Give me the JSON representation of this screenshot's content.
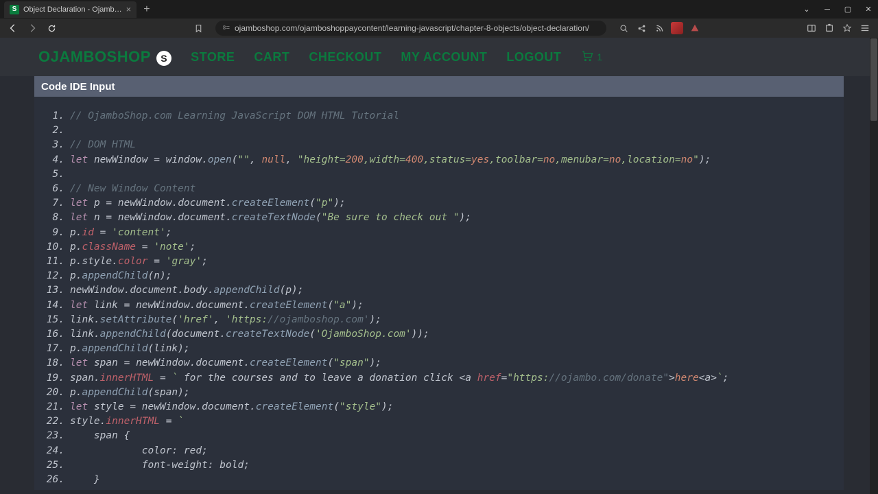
{
  "browser": {
    "tab_title": "Object Declaration - Ojamb…",
    "url": "ojamboshop.com/ojamboshoppaycontent/learning-javascript/chapter-8-objects/object-declaration/",
    "cart_count": "1"
  },
  "nav": {
    "brand": "OJAMBOSHOP",
    "links": [
      "STORE",
      "CART",
      "CHECKOUT",
      "MY ACCOUNT",
      "LOGOUT"
    ]
  },
  "panel": {
    "title": "Code IDE Input"
  },
  "code_lines": [
    {
      "n": "1",
      "html": "<span class='cm'>// OjamboShop.com Learning JavaScript DOM HTML Tutorial</span>"
    },
    {
      "n": "2",
      "html": ""
    },
    {
      "n": "3",
      "html": "<span class='cm'>// DOM HTML</span>"
    },
    {
      "n": "4",
      "html": "<span class='kw'>let</span> <span class='id'>newWindow</span> <span class='op'>=</span> <span class='id'>window</span>.<span class='fn'>open</span><span class='pn'>(</span><span class='st'>\"\"</span><span class='pn'>,</span> <span class='bool'>null</span><span class='pn'>,</span> <span class='st'>\"height=</span><span class='nm'>200</span><span class='st'>,width=</span><span class='nm'>400</span><span class='st'>,status=</span><span class='bool'>yes</span><span class='st'>,toolbar=</span><span class='bool'>no</span><span class='st'>,menubar=</span><span class='bool'>no</span><span class='st'>,location=</span><span class='bool'>no</span><span class='st'>\"</span><span class='pn'>);</span>"
    },
    {
      "n": "5",
      "html": ""
    },
    {
      "n": "6",
      "html": "<span class='cm'>// New Window Content</span>"
    },
    {
      "n": "7",
      "html": "<span class='kw'>let</span> <span class='id'>p</span> <span class='op'>=</span> <span class='id'>newWindow</span>.<span class='id'>document</span>.<span class='fn'>createElement</span><span class='pn'>(</span><span class='st'>\"p\"</span><span class='pn'>);</span>"
    },
    {
      "n": "8",
      "html": "<span class='kw'>let</span> <span class='id'>n</span> <span class='op'>=</span> <span class='id'>newWindow</span>.<span class='id'>document</span>.<span class='fn'>createTextNode</span><span class='pn'>(</span><span class='st'>\"Be sure to check out \"</span><span class='pn'>);</span>"
    },
    {
      "n": "9",
      "html": "<span class='id'>p</span>.<span class='pr'>id</span> <span class='op'>=</span> <span class='st'>'content'</span><span class='pn'>;</span>"
    },
    {
      "n": "10",
      "html": "<span class='id'>p</span>.<span class='pr'>className</span> <span class='op'>=</span> <span class='st'>'note'</span><span class='pn'>;</span>"
    },
    {
      "n": "11",
      "html": "<span class='id'>p</span>.<span class='id'>style</span>.<span class='pr'>color</span> <span class='op'>=</span> <span class='st'>'gray'</span><span class='pn'>;</span>"
    },
    {
      "n": "12",
      "html": "<span class='id'>p</span>.<span class='fn'>appendChild</span><span class='pn'>(</span><span class='id'>n</span><span class='pn'>);</span>"
    },
    {
      "n": "13",
      "html": "<span class='id'>newWindow</span>.<span class='id'>document</span>.<span class='id'>body</span>.<span class='fn'>appendChild</span><span class='pn'>(</span><span class='id'>p</span><span class='pn'>);</span>"
    },
    {
      "n": "14",
      "html": "<span class='kw'>let</span> <span class='id'>link</span> <span class='op'>=</span> <span class='id'>newWindow</span>.<span class='id'>document</span>.<span class='fn'>createElement</span><span class='pn'>(</span><span class='st'>\"a\"</span><span class='pn'>);</span>"
    },
    {
      "n": "15",
      "html": "<span class='id'>link</span>.<span class='fn'>setAttribute</span><span class='pn'>(</span><span class='st'>'href'</span><span class='pn'>,</span> <span class='st'>'https:</span><span class='cm'>//ojamboshop.com'</span><span class='pn'>);</span>"
    },
    {
      "n": "16",
      "html": "<span class='id'>link</span>.<span class='fn'>appendChild</span><span class='pn'>(</span><span class='id'>document</span>.<span class='fn'>createTextNode</span><span class='pn'>(</span><span class='st'>'OjamboShop.com'</span><span class='pn'>));</span>"
    },
    {
      "n": "17",
      "html": "<span class='id'>p</span>.<span class='fn'>appendChild</span><span class='pn'>(</span><span class='id'>link</span><span class='pn'>);</span>"
    },
    {
      "n": "18",
      "html": "<span class='kw'>let</span> <span class='id'>span</span> <span class='op'>=</span> <span class='id'>newWindow</span>.<span class='id'>document</span>.<span class='fn'>createElement</span><span class='pn'>(</span><span class='st'>\"span\"</span><span class='pn'>);</span>"
    },
    {
      "n": "19",
      "html": "<span class='id'>span</span>.<span class='pr'>innerHTML</span> <span class='op'>=</span> <span class='st'>`</span> <span class='id'>for the courses and to leave a donation click </span><span class='op'>&lt;</span><span class='id'>a</span> <span class='pr'>href</span><span class='op'>=</span><span class='st'>\"https:</span><span class='cm'>//ojambo.com/donate\"</span><span class='op'>&gt;</span><span class='bool'>here</span><span class='op'>&lt;</span><span class='id'>a</span><span class='op'>&gt;</span><span class='st'>`</span><span class='pn'>;</span>"
    },
    {
      "n": "20",
      "html": "<span class='id'>p</span>.<span class='fn'>appendChild</span><span class='pn'>(</span><span class='id'>span</span><span class='pn'>);</span>"
    },
    {
      "n": "21",
      "html": "<span class='kw'>let</span> <span class='id'>style</span> <span class='op'>=</span> <span class='id'>newWindow</span>.<span class='id'>document</span>.<span class='fn'>createElement</span><span class='pn'>(</span><span class='st'>\"style\"</span><span class='pn'>);</span>"
    },
    {
      "n": "22",
      "html": "<span class='id'>style</span>.<span class='pr'>innerHTML</span> <span class='op'>=</span> <span class='st'>`</span>"
    },
    {
      "n": "23",
      "html": "    <span class='id'>span</span> <span class='brace'>{</span>"
    },
    {
      "n": "24",
      "html": "            <span class='id'>color: red;</span>"
    },
    {
      "n": "25",
      "html": "            <span class='id'>font-weight: bold;</span>"
    },
    {
      "n": "26",
      "html": "    <span class='brace'>}</span>"
    }
  ]
}
